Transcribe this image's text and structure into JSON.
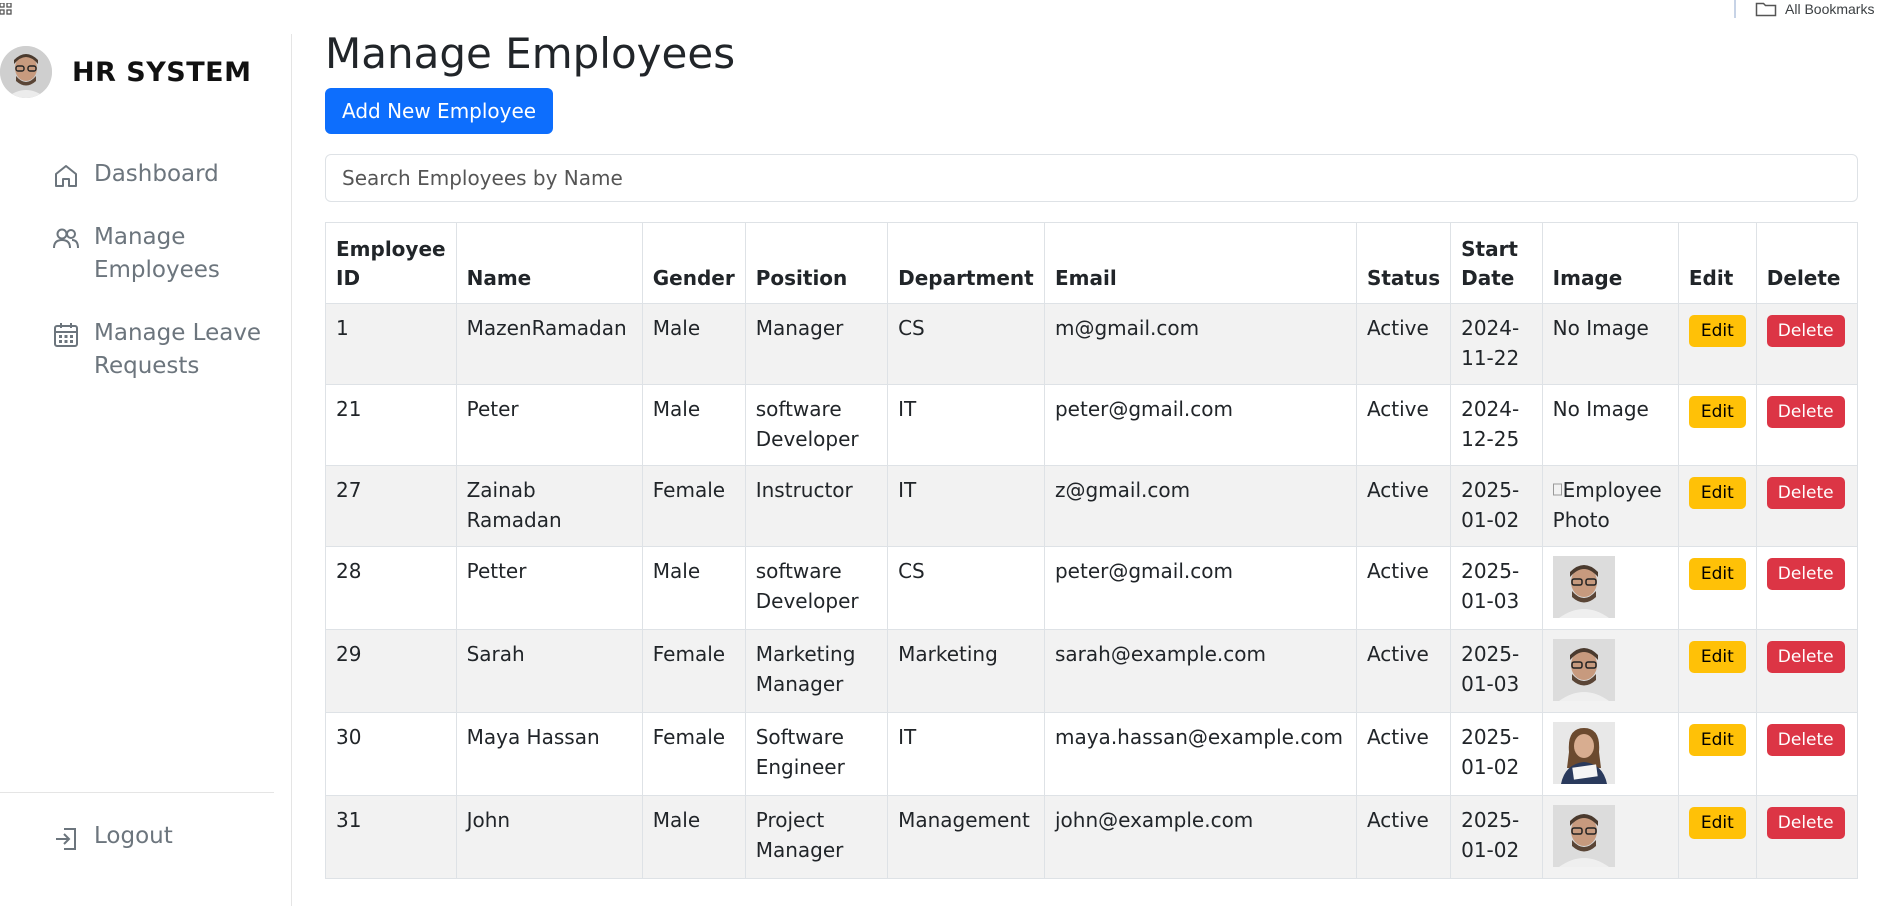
{
  "browser": {
    "all_bookmarks_label": "All Bookmarks",
    "apps_icon": "apps-grid-icon",
    "folder_icon": "folder-icon"
  },
  "sidebar": {
    "brand_title": "HR SYSTEM",
    "brand_avatar": "avatar",
    "items": [
      {
        "label": "Dashboard",
        "icon": "home-icon"
      },
      {
        "label": "Manage Employees",
        "icon": "users-icon"
      },
      {
        "label": "Manage Leave Requests",
        "icon": "calendar-icon"
      }
    ],
    "logout_label": "Logout",
    "logout_icon": "logout-icon"
  },
  "main": {
    "title": "Manage Employees",
    "add_button_label": "Add New Employee",
    "search_placeholder": "Search Employees by Name",
    "columns": [
      "Employee ID",
      "Name",
      "Gender",
      "Position",
      "Department",
      "Email",
      "Status",
      "Start Date",
      "Image",
      "Edit",
      "Delete"
    ],
    "edit_label": "Edit",
    "delete_label": "Delete",
    "rows": [
      {
        "id": "1",
        "name": "MazenRamadan",
        "gender": "Male",
        "position": "Manager",
        "department": "CS",
        "email": "m@gmail.com",
        "status": "Active",
        "start_date": "2024-11-22",
        "image": "No Image"
      },
      {
        "id": "21",
        "name": "Peter",
        "gender": "Male",
        "position": "software Developer",
        "department": "IT",
        "email": "peter@gmail.com",
        "status": "Active",
        "start_date": "2024-12-25",
        "image": "No Image"
      },
      {
        "id": "27",
        "name": "Zainab Ramadan",
        "gender": "Female",
        "position": "Instructor",
        "department": "IT",
        "email": "z@gmail.com",
        "status": "Active",
        "start_date": "2025-01-02",
        "image": "Employee Photo"
      },
      {
        "id": "28",
        "name": "Petter",
        "gender": "Male",
        "position": "software Developer",
        "department": "CS",
        "email": "peter@gmail.com",
        "status": "Active",
        "start_date": "2025-01-03",
        "image": ""
      },
      {
        "id": "29",
        "name": "Sarah",
        "gender": "Female",
        "position": "Marketing Manager",
        "department": "Marketing",
        "email": "sarah@example.com",
        "status": "Active",
        "start_date": "2025-01-03",
        "image": ""
      },
      {
        "id": "30",
        "name": "Maya Hassan",
        "gender": "Female",
        "position": "Software Engineer",
        "department": "IT",
        "email": "maya.hassan@example.com",
        "status": "Active",
        "start_date": "2025-01-02",
        "image": ""
      },
      {
        "id": "31",
        "name": "John",
        "gender": "Male",
        "position": "Project Manager",
        "department": "Management",
        "email": "john@example.com",
        "status": "Active",
        "start_date": "2025-01-02",
        "image": ""
      }
    ]
  },
  "colors": {
    "primary": "#0d6efd",
    "edit": "#ffc107",
    "delete": "#dc3545",
    "stripe": "#f2f2f2"
  }
}
